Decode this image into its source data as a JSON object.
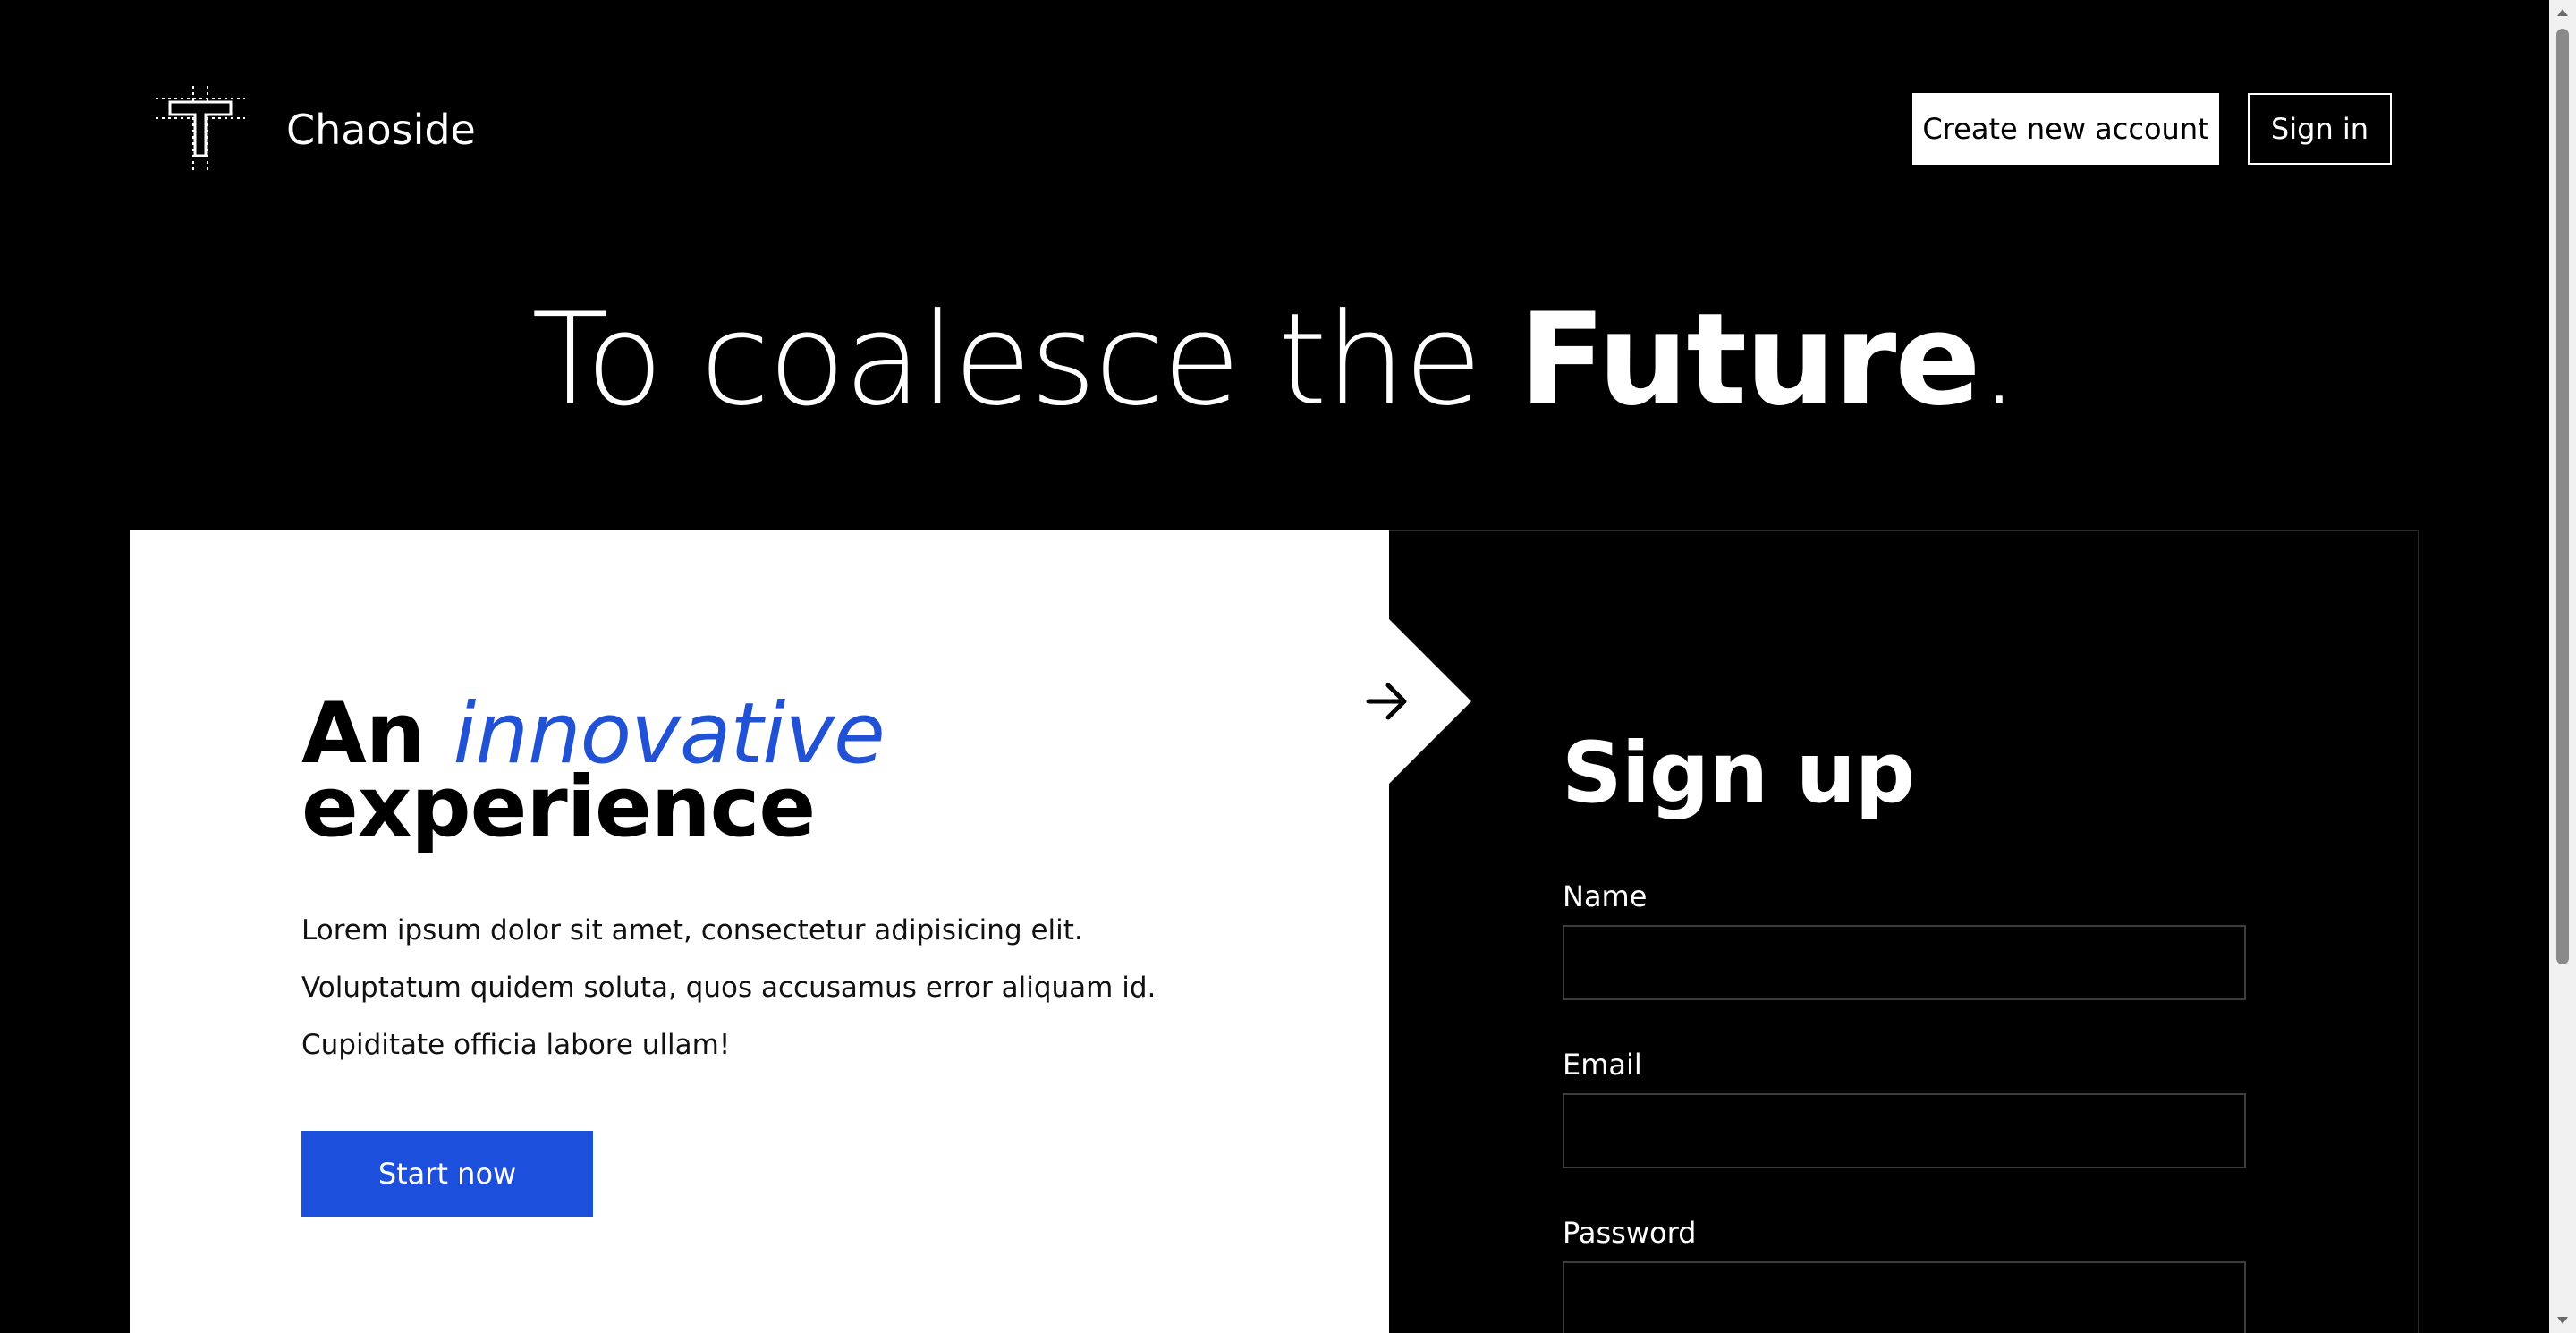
{
  "header": {
    "brand": "Chaoside",
    "create_account_label": "Create new account",
    "sign_in_label": "Sign in"
  },
  "hero": {
    "text_light": "To coalesce the ",
    "text_bold": "Future",
    "text_end": "."
  },
  "feature": {
    "heading_plain": "An ",
    "heading_accent": "innovative",
    "heading_line2": "experience",
    "body": "Lorem ipsum dolor sit amet, consectetur adipisicing elit. Voluptatum quidem soluta, quos accusamus error aliquam id. Cupiditate officia labore ullam!",
    "cta_label": "Start now"
  },
  "signup": {
    "title": "Sign up",
    "fields": {
      "name": {
        "label": "Name",
        "value": ""
      },
      "email": {
        "label": "Email",
        "value": ""
      },
      "password": {
        "label": "Password",
        "value": ""
      }
    }
  },
  "colors": {
    "background": "#000000",
    "accent": "#1c4fdc",
    "accent_text": "#2152d6",
    "card_light": "#ffffff"
  },
  "icons": {
    "logo": "t-grid-logo-icon",
    "arrow": "arrow-right-icon",
    "scroll_up": "chevron-up-icon",
    "scroll_down": "chevron-down-icon"
  }
}
